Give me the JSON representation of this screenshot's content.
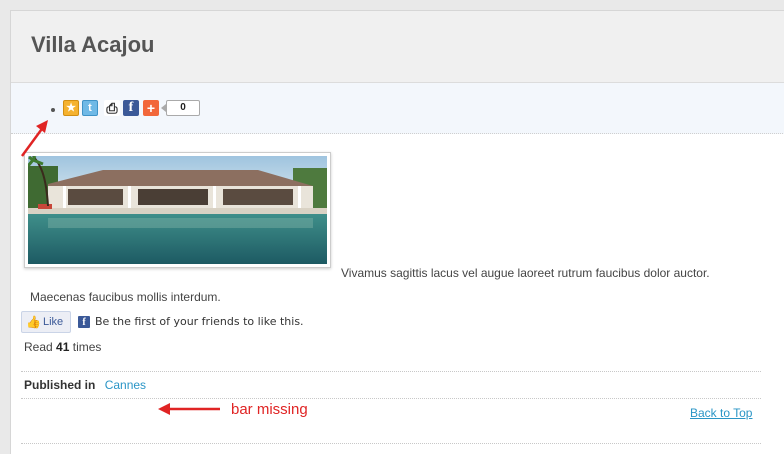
{
  "article": {
    "title": "Villa Acajou",
    "body_line1": "Vivamus sagittis lacus vel augue laoreet rutrum faucibus dolor auctor.",
    "body_line2": "Maecenas faucibus mollis interdum."
  },
  "share": {
    "icons": [
      "favorite-star-icon",
      "twitter-icon",
      "print-icon",
      "facebook-icon",
      "addthis-plus-icon"
    ],
    "count": "0"
  },
  "facebook": {
    "like_label": "Like",
    "social_text": "Be the first of your friends to like this."
  },
  "meta": {
    "read_prefix": "Read",
    "read_count": "41",
    "read_suffix": "times",
    "published_label": "Published in",
    "category": "Cannes"
  },
  "footer": {
    "back_to_top": "Back to Top"
  },
  "annotations": {
    "bar_missing": "bar missing",
    "color": "#e02424"
  },
  "colors": {
    "link": "#2a95c6",
    "facebook": "#3b5998",
    "share_bar_bg": "#f3f7fc"
  }
}
